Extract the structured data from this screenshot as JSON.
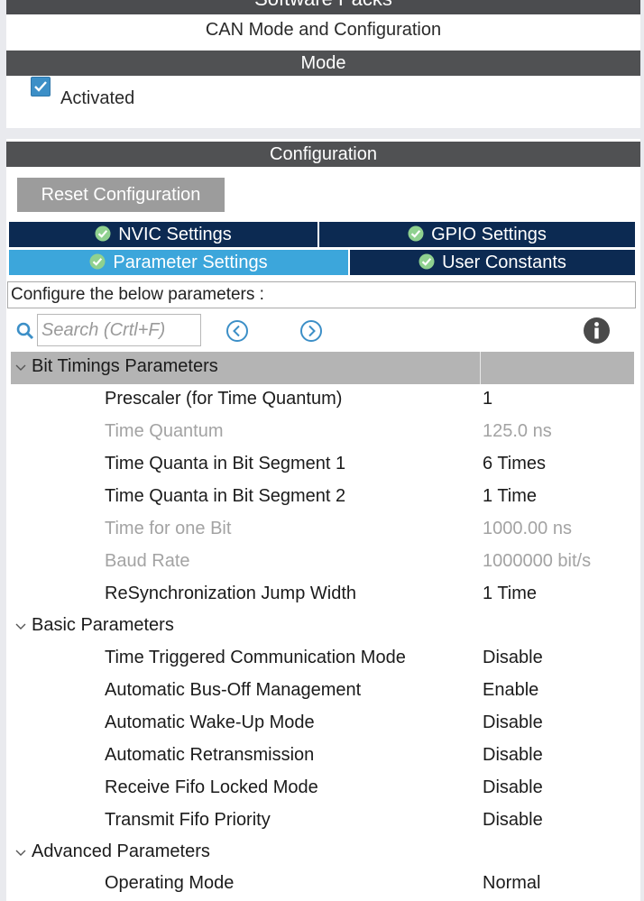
{
  "header": {
    "title": "Software Packs"
  },
  "panel": {
    "title": "CAN Mode and Configuration"
  },
  "mode": {
    "section_label": "Mode",
    "activated_label": "Activated",
    "activated": true
  },
  "configuration": {
    "section_label": "Configuration",
    "reset_label": "Reset Configuration"
  },
  "tabs": [
    {
      "label": "NVIC Settings",
      "active": false
    },
    {
      "label": "GPIO Settings",
      "active": false
    },
    {
      "label": "Parameter Settings",
      "active": true
    },
    {
      "label": "User Constants",
      "active": false
    }
  ],
  "configure_text": "Configure the below parameters :",
  "search": {
    "placeholder": "Search (Crtl+F)"
  },
  "icons": {
    "search": "search-icon",
    "prev": "chevron-left-circle-icon",
    "next": "chevron-right-circle-icon",
    "info": "info-icon",
    "check": "check-circle-icon",
    "collapse": "chevron-down-icon"
  },
  "colors": {
    "active_tab": "#3ca6db",
    "inactive_tab": "#0c2a52",
    "checkbox": "#3c8fc7",
    "section_bar": "#505153",
    "group_shade": "#b4b4b4"
  },
  "groups": [
    {
      "label": "Bit Timings Parameters",
      "params": [
        {
          "name": "Prescaler (for Time Quantum)",
          "value": "1",
          "editable": true
        },
        {
          "name": "Time Quantum",
          "value": "125.0 ns",
          "editable": false
        },
        {
          "name": "Time Quanta in Bit Segment 1",
          "value": "6 Times",
          "editable": true
        },
        {
          "name": "Time Quanta in Bit Segment 2",
          "value": "1 Time",
          "editable": true
        },
        {
          "name": "Time for one Bit",
          "value": "1000.00 ns",
          "editable": false
        },
        {
          "name": "Baud Rate",
          "value": "1000000 bit/s",
          "editable": false
        },
        {
          "name": "ReSynchronization Jump Width",
          "value": "1 Time",
          "editable": true
        }
      ]
    },
    {
      "label": "Basic Parameters",
      "params": [
        {
          "name": "Time Triggered Communication Mode",
          "value": "Disable",
          "editable": true
        },
        {
          "name": "Automatic Bus-Off Management",
          "value": "Enable",
          "editable": true
        },
        {
          "name": "Automatic Wake-Up Mode",
          "value": "Disable",
          "editable": true
        },
        {
          "name": "Automatic Retransmission",
          "value": "Disable",
          "editable": true
        },
        {
          "name": "Receive Fifo Locked Mode",
          "value": "Disable",
          "editable": true
        },
        {
          "name": "Transmit Fifo Priority",
          "value": "Disable",
          "editable": true
        }
      ]
    },
    {
      "label": "Advanced Parameters",
      "params": [
        {
          "name": "Operating Mode",
          "value": "Normal",
          "editable": true
        }
      ]
    }
  ]
}
